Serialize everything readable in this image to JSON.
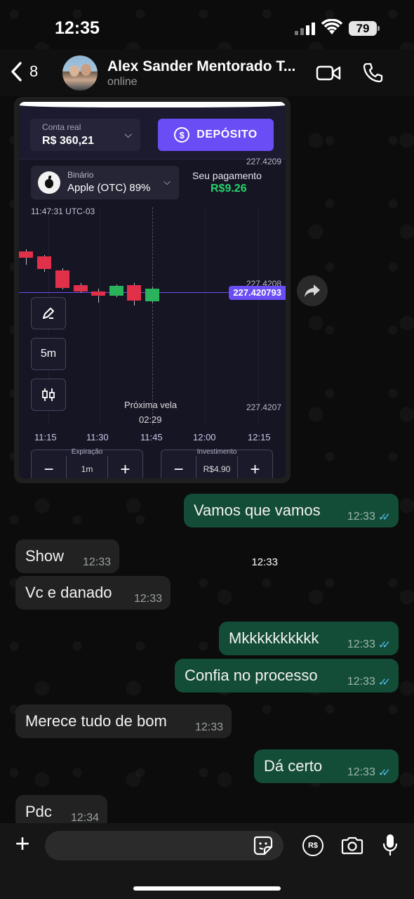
{
  "status_bar": {
    "time": "12:35",
    "battery": "79"
  },
  "header": {
    "back_count": "8",
    "contact_name": "Alex Sander Mentorado T...",
    "contact_status": "online"
  },
  "image_message": {
    "account_label": "Conta real",
    "account_value": "R$ 360,21",
    "deposit_label": "DEPÓSITO",
    "deposit_symbol": "$",
    "asset_type": "Binário",
    "asset_name": "Apple (OTC) 89%",
    "payout_label": "Seu pagamento",
    "payout_value": "R$9.26",
    "clock": "11:47:31 UTC-03",
    "price_top": "227.4209",
    "price_mid": "227.4208",
    "price_current": "227.420793",
    "price_bottom": "227.4207",
    "timeframe": "5m",
    "next_candle_label": "Próxima vela",
    "next_candle_time": "02:29",
    "x_ticks": [
      "11:15",
      "11:30",
      "11:45",
      "12:00",
      "12:15"
    ],
    "expiry_label": "Expiração",
    "expiry_value": "1m",
    "invest_label": "Investimento",
    "invest_value": "R$4.90",
    "minus": "−",
    "plus": "+",
    "time": "12:33"
  },
  "messages": [
    {
      "direction": "out",
      "text": "Vamos que vamos",
      "time": "12:33",
      "read": true
    },
    {
      "direction": "in",
      "text": "Show",
      "time": "12:33"
    },
    {
      "direction": "in",
      "text": "Vc e danado",
      "time": "12:33"
    },
    {
      "direction": "out",
      "text": "Mkkkkkkkkkk",
      "time": "12:33",
      "read": true
    },
    {
      "direction": "out",
      "text": "Confia no processo",
      "time": "12:33",
      "read": true
    },
    {
      "direction": "in",
      "text": "Merece tudo de bom",
      "time": "12:33"
    },
    {
      "direction": "out",
      "text": "Dá certo",
      "time": "12:33",
      "read": true
    },
    {
      "direction": "in",
      "text": "Pdc",
      "time": "12:34"
    }
  ],
  "read_ticks": "✓✓",
  "input_bar": {
    "placeholder": "",
    "pix_label": "R$"
  },
  "colors": {
    "outgoing_bubble": "#144d37",
    "incoming_bubble": "#222222",
    "read_ticks": "#53bdeb",
    "deposit_button": "#6a4df5",
    "payout_green": "#23d36b"
  },
  "icons": [
    "back-chevron-icon",
    "video-call-icon",
    "phone-icon",
    "forward-icon",
    "plus-icon",
    "sticker-icon",
    "pix-icon",
    "camera-icon",
    "microphone-icon"
  ]
}
